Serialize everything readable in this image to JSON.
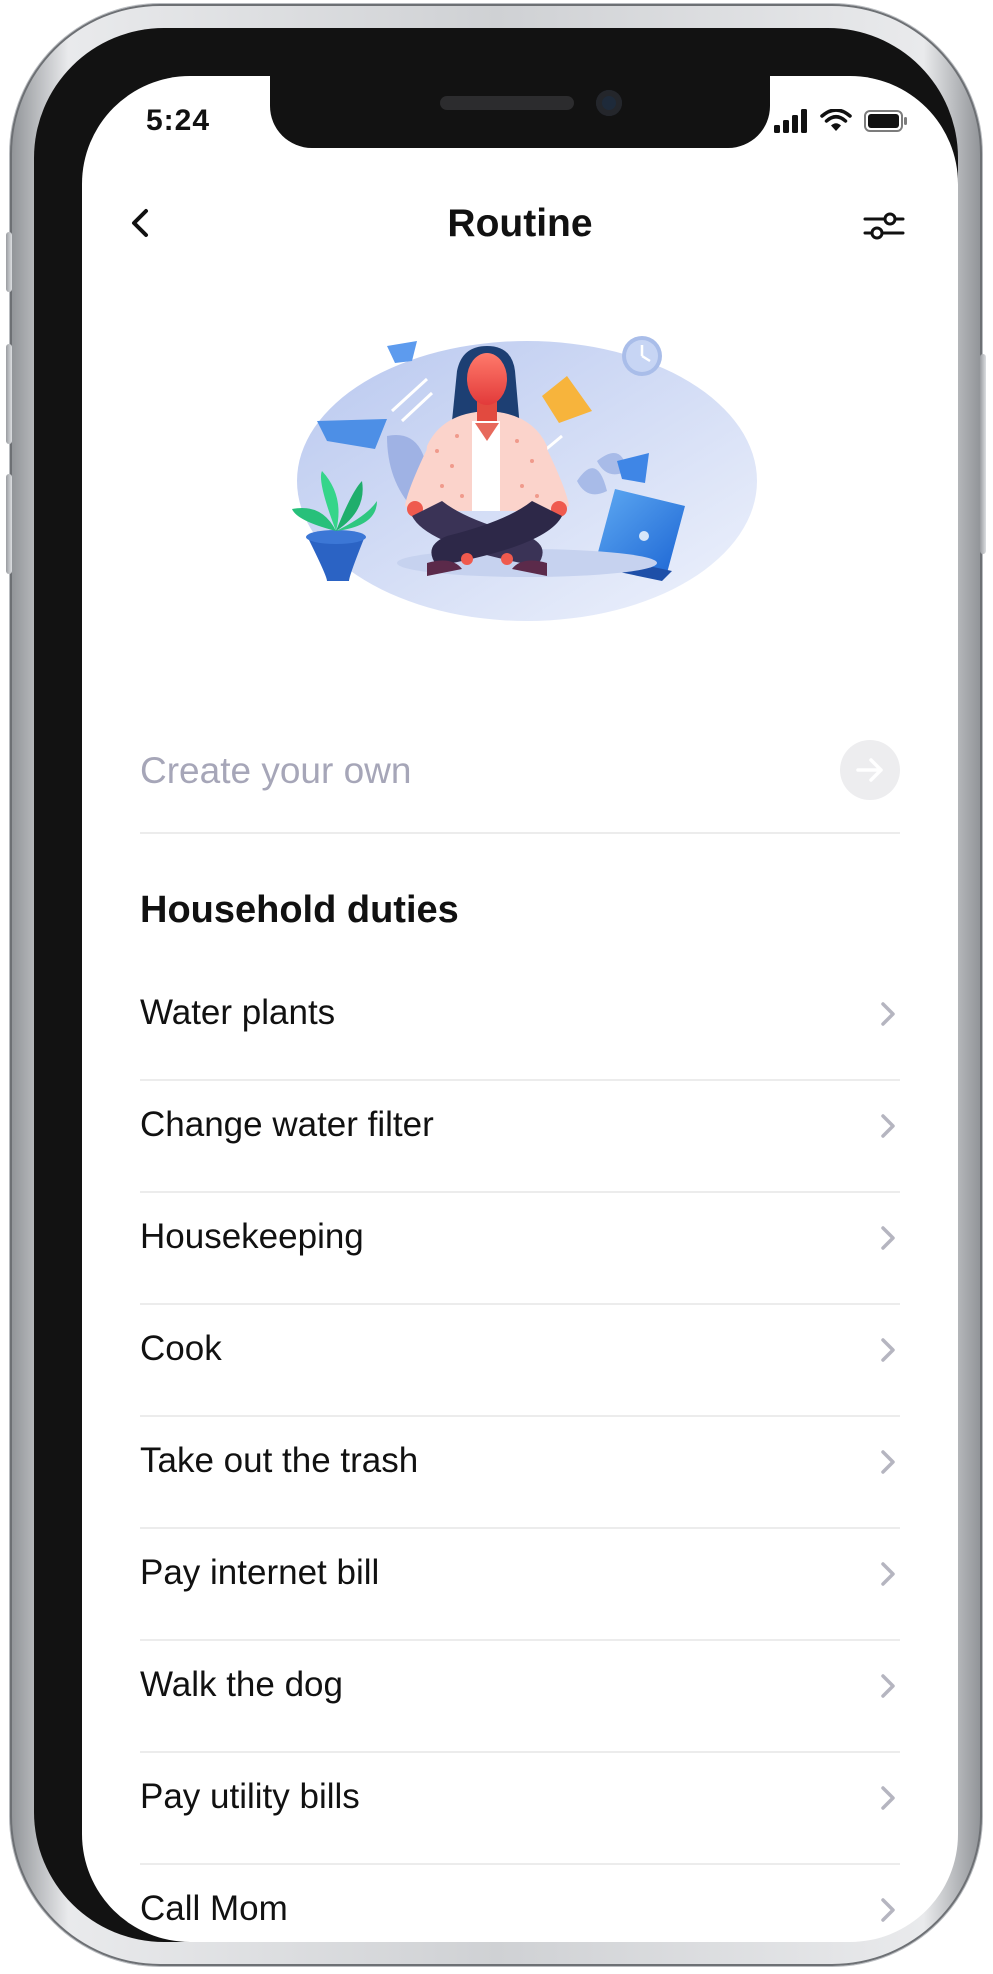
{
  "status_bar": {
    "time": "5:24"
  },
  "header": {
    "title": "Routine"
  },
  "create": {
    "placeholder": "Create your own"
  },
  "section": {
    "title": "Household duties",
    "items": [
      {
        "label": "Water plants"
      },
      {
        "label": "Change water filter"
      },
      {
        "label": "Housekeeping"
      },
      {
        "label": "Cook"
      },
      {
        "label": "Take out the trash"
      },
      {
        "label": "Pay internet bill"
      },
      {
        "label": "Walk the dog"
      },
      {
        "label": "Pay utility bills"
      },
      {
        "label": "Call Mom"
      }
    ]
  },
  "colors": {
    "placeholder": "#a6a6b8",
    "divider": "#ececec",
    "chevron": "#b5b5c0",
    "illustration_blob": "#dbe5f8"
  },
  "icons": [
    "back-arrow-icon",
    "sliders-icon",
    "arrow-right-icon",
    "chevron-right-icon",
    "signal-icon",
    "wifi-icon",
    "battery-icon"
  ]
}
